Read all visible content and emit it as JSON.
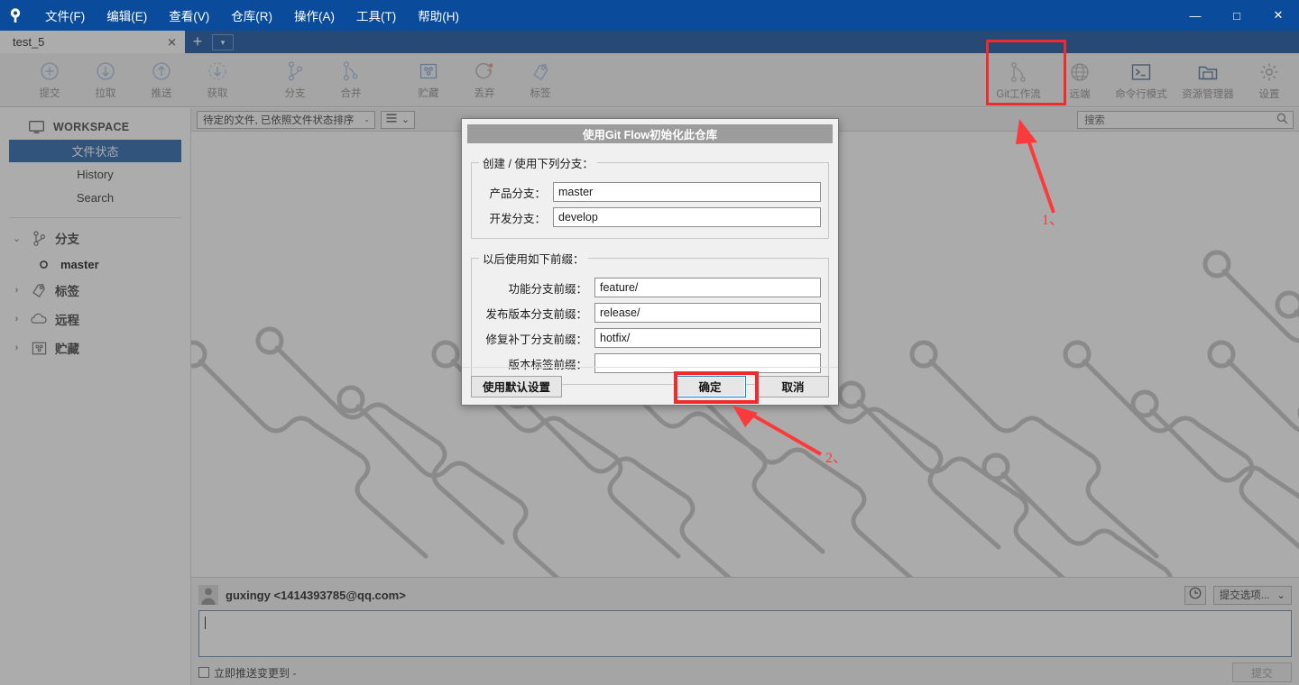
{
  "window": {
    "menu": [
      {
        "label": "文件(F)",
        "mnemonic": "F"
      },
      {
        "label": "编辑(E)",
        "mnemonic": "E"
      },
      {
        "label": "查看(V)",
        "mnemonic": "V"
      },
      {
        "label": "仓库(R)",
        "mnemonic": "R"
      },
      {
        "label": "操作(A)",
        "mnemonic": "A"
      },
      {
        "label": "工具(T)",
        "mnemonic": "T"
      },
      {
        "label": "帮助(H)",
        "mnemonic": "H"
      }
    ],
    "controls": {
      "minimize": "—",
      "maximize": "□",
      "close": "✕"
    },
    "accent_color": "#0b4b9c"
  },
  "tabs": {
    "active": "test_5",
    "close_glyph": "✕",
    "new_tab_glyph": "+",
    "dropdown_glyph": "▾"
  },
  "toolbar": {
    "left_items": [
      {
        "label": "提交",
        "icon": "commit-plus-icon"
      },
      {
        "label": "拉取",
        "icon": "pull-down-arrow-icon"
      },
      {
        "label": "推送",
        "icon": "push-up-arrow-icon"
      },
      {
        "label": "获取",
        "icon": "fetch-dashed-arrow-icon"
      },
      {
        "label": "分支",
        "icon": "branch-icon"
      },
      {
        "label": "合并",
        "icon": "merge-icon"
      },
      {
        "label": "贮藏",
        "icon": "stash-icon"
      },
      {
        "label": "丢弃",
        "icon": "discard-refresh-icon"
      },
      {
        "label": "标签",
        "icon": "tag-icon"
      }
    ],
    "right_items": [
      {
        "label": "Git工作流",
        "icon": "git-flow-icon"
      },
      {
        "label": "远端",
        "icon": "globe-icon"
      },
      {
        "label": "命令行模式",
        "icon": "terminal-icon"
      },
      {
        "label": "资源管理器",
        "icon": "folder-explorer-icon"
      },
      {
        "label": "设置",
        "icon": "gear-icon"
      }
    ]
  },
  "sidebar": {
    "workspace_label": "WORKSPACE",
    "workspace_items": [
      {
        "label": "文件状态",
        "active": true
      },
      {
        "label": "History",
        "active": false
      },
      {
        "label": "Search",
        "active": false
      }
    ],
    "trees": [
      {
        "label": "分支",
        "icon": "branch-icon",
        "expanded": true,
        "chevron": "⌄",
        "children": [
          {
            "label": "master",
            "icon": "branch-dot-icon"
          }
        ]
      },
      {
        "label": "标签",
        "icon": "tag-icon",
        "expanded": false,
        "chevron": "›",
        "children": []
      },
      {
        "label": "远程",
        "icon": "cloud-icon",
        "expanded": false,
        "chevron": "›",
        "children": []
      },
      {
        "label": "贮藏",
        "icon": "stash-icon",
        "expanded": false,
        "chevron": "›",
        "children": []
      }
    ]
  },
  "filterbar": {
    "sort_value": "待定的文件, 已依照文件状态排序",
    "sort_chevron": "⌄",
    "view_icon": "list-lines-icon",
    "view_chevron": "⌄",
    "search_placeholder": "搜索",
    "search_icon": "search-icon"
  },
  "commit": {
    "author": "guxingy <1414393785@qq.com>",
    "avatar_icon": "user-avatar-icon",
    "history_icon": "clock-history-icon",
    "options_label": "提交选项...",
    "options_chevron": "⌄",
    "message_value": "",
    "push_checkbox_label": "立即推送变更到 -",
    "push_checked": false,
    "submit_label": "提交",
    "submit_disabled": true
  },
  "dialog": {
    "title": "使用Git Flow初始化此仓库",
    "group1_legend": "创建 / 使用下列分支：",
    "group1_fields": [
      {
        "label": "产品分支：",
        "value": "master"
      },
      {
        "label": "开发分支：",
        "value": "develop"
      }
    ],
    "group2_legend": "以后使用如下前缀：",
    "group2_fields": [
      {
        "label": "功能分支前缀：",
        "value": "feature/"
      },
      {
        "label": "发布版本分支前缀：",
        "value": "release/"
      },
      {
        "label": "修复补丁分支前缀：",
        "value": "hotfix/"
      },
      {
        "label": "版本标签前缀：",
        "value": ""
      }
    ],
    "defaults_button": "使用默认设置",
    "ok_button": "确定",
    "cancel_button": "取消"
  },
  "annotations": [
    {
      "id": "1",
      "label": "1、",
      "target": "git-flow-toolbar-button",
      "color": "#fb3b3b"
    },
    {
      "id": "2",
      "label": "2、",
      "target": "dialog-ok-button",
      "color": "#fb3b3b"
    }
  ]
}
